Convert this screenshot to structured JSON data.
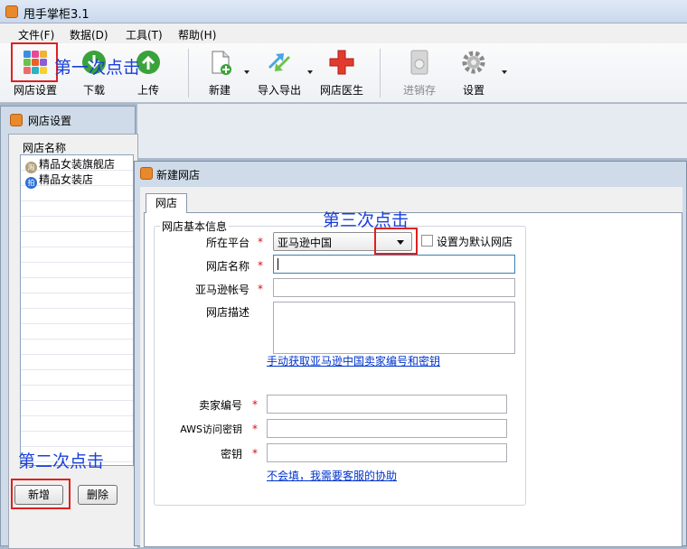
{
  "app": {
    "title": "甩手掌柜3.1"
  },
  "menu": [
    "文件(F)",
    "数据(D)",
    "工具(T)",
    "帮助(H)"
  ],
  "toolbar": {
    "shop_settings": "网店设置",
    "download": "下载",
    "upload": "上传",
    "new": "新建",
    "import_export": "导入导出",
    "shop_doctor": "网店医生",
    "inventory": "进销存",
    "settings": "设置"
  },
  "annotations": {
    "first": "第一次点击",
    "second": "第二次点击",
    "third": "第三次点击"
  },
  "shop_window": {
    "title": "网店设置",
    "list_header": "网店名称",
    "shops": [
      {
        "name": "精品女装旗舰店",
        "badge": "淘"
      },
      {
        "name": "精品女装店",
        "badge": "拍"
      }
    ],
    "add_button": "新增",
    "delete_button": "删除"
  },
  "dialog": {
    "title": "新建网店",
    "tab": "网店",
    "group_title": "网店基本信息",
    "platform_label": "所在平台",
    "platform_value": "亚马逊中国",
    "default_checkbox": "设置为默认网店",
    "name_label": "网店名称",
    "account_label": "亚马逊帐号",
    "desc_label": "网店描述",
    "get_keys_link": "手动获取亚马逊中国卖家编号和密钥",
    "seller_id_label": "卖家编号",
    "aws_key_label": "AWS访问密钥",
    "secret_label": "密钥",
    "help_link": "不会填，我需要客服的协助",
    "required_mark": "*"
  },
  "colors": {
    "accent_red": "#e02020",
    "annotation_blue": "#1a3fd8",
    "link_blue": "#0033cc"
  }
}
